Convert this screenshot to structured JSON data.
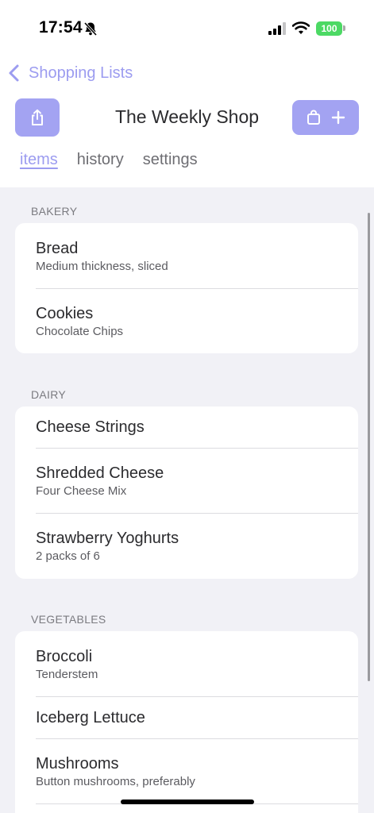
{
  "status_bar": {
    "time": "17:54",
    "battery": "100",
    "battery_color": "#4cd964"
  },
  "nav": {
    "back_label": "Shopping Lists",
    "title": "The Weekly Shop",
    "share_icon": "share-icon",
    "add_icons": [
      "shopping-bag-icon",
      "plus-icon"
    ],
    "accent_color": "#9c9cf0"
  },
  "tabs": [
    {
      "label": "items",
      "active": true
    },
    {
      "label": "history",
      "active": false
    },
    {
      "label": "settings",
      "active": false
    }
  ],
  "sections": [
    {
      "header": "BAKERY",
      "items": [
        {
          "title": "Bread",
          "subtitle": "Medium thickness, sliced"
        },
        {
          "title": "Cookies",
          "subtitle": "Chocolate Chips"
        }
      ]
    },
    {
      "header": "DAIRY",
      "items": [
        {
          "title": "Cheese Strings",
          "subtitle": ""
        },
        {
          "title": "Shredded Cheese",
          "subtitle": "Four Cheese Mix"
        },
        {
          "title": "Strawberry Yoghurts",
          "subtitle": "2 packs of 6"
        }
      ]
    },
    {
      "header": "VEGETABLES",
      "items": [
        {
          "title": "Broccoli",
          "subtitle": "Tenderstem"
        },
        {
          "title": "Iceberg Lettuce",
          "subtitle": ""
        },
        {
          "title": "Mushrooms",
          "subtitle": "Button mushrooms, preferably"
        }
      ]
    }
  ]
}
